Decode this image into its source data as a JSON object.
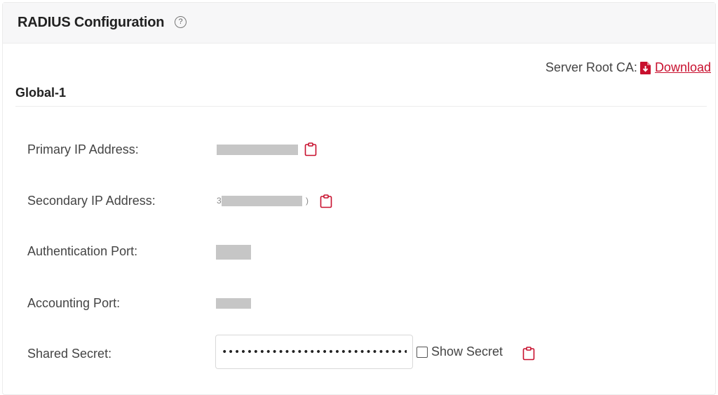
{
  "header": {
    "title": "RADIUS Configuration",
    "help_icon": "?"
  },
  "server_root_ca": {
    "label": "Server Root CA:",
    "icon": "pdf-download-icon",
    "link_label": "Download"
  },
  "section": {
    "title": "Global-1"
  },
  "fields": {
    "primary_ip": {
      "label": "Primary IP Address:",
      "value_masked": true
    },
    "secondary_ip": {
      "label": "Secondary IP Address:",
      "value_masked": true,
      "visible_prefix": "3",
      "visible_suffix": ")"
    },
    "auth_port": {
      "label": "Authentication Port:",
      "value_masked": true
    },
    "acct_port": {
      "label": "Accounting Port:",
      "value_masked": true
    },
    "shared_secret": {
      "label": "Shared Secret:",
      "value": "••••••••••••••••••••••••••••••••",
      "show_secret_label": "Show Secret",
      "show_secret_checked": false
    }
  },
  "colors": {
    "accent": "#c8102e",
    "header_bg": "#f7f7f8",
    "mask": "#c6c6c6"
  }
}
